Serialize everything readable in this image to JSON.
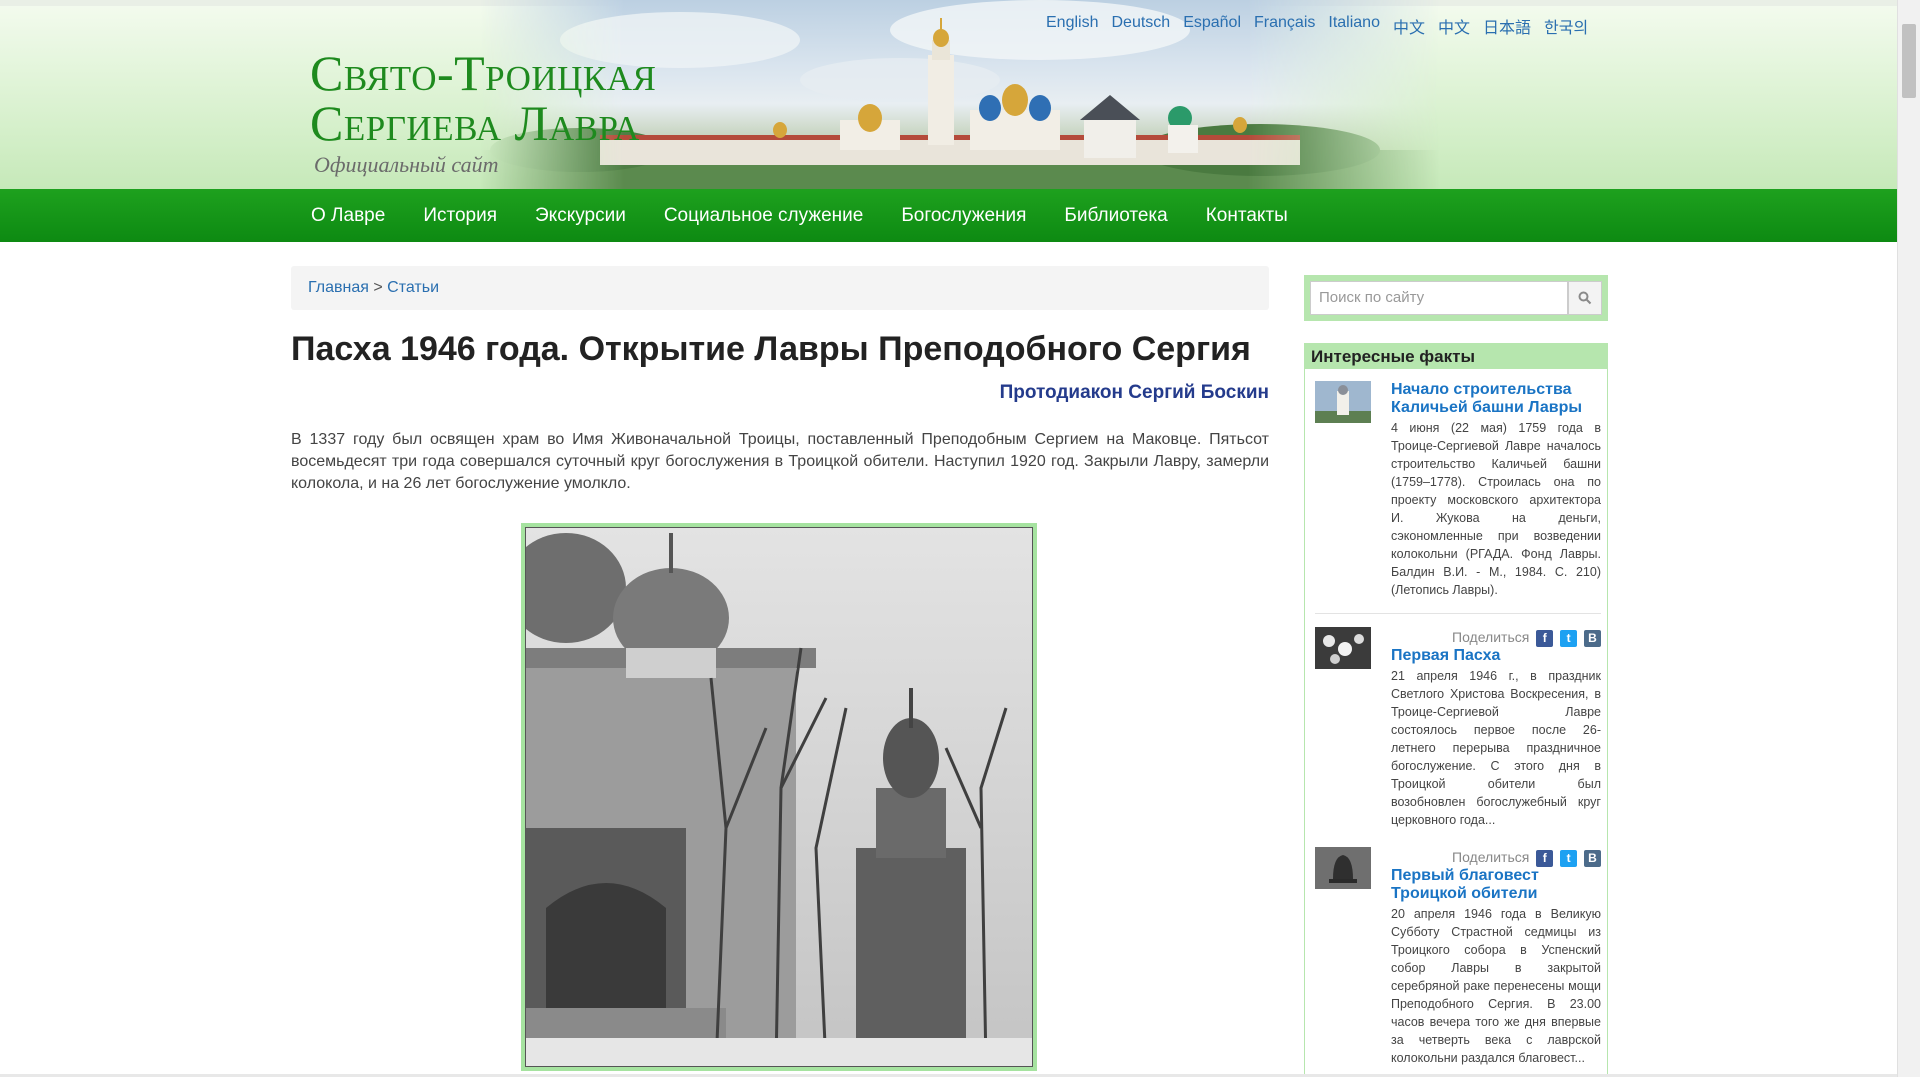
{
  "header": {
    "logo_line1": "Свято-Троицкая",
    "logo_line2": "Сергиева Лавра",
    "logo_subtitle": "Официальный сайт",
    "languages": [
      "English",
      "Deutsch",
      "Español",
      "Français",
      "Italiano",
      "中文",
      "中文",
      "日本語",
      "한국의"
    ]
  },
  "nav": {
    "items": [
      "О Лавре",
      "История",
      "Экскурсии",
      "Социальное служение",
      "Богослужения",
      "Библиотека",
      "Контакты"
    ]
  },
  "breadcrumb": {
    "home": "Главная",
    "separator": ">",
    "current": "Статьи"
  },
  "article": {
    "title": "Пасха 1946 года. Открытие Лавры Преподобного Сергия",
    "author": "Протодиакон Сергий Боскин",
    "lead": "В 1337 году был освящен храм во Имя Живоначальной Троицы, поставленный Преподобным Сергием на Маковце. Пятьсот восемьдесят три года совершался суточный круг богослужения в Троицкой обители. Наступил 1920 год. Закрыли Лавру, замерли колокола, и на 26 лет богослужение умолкло."
  },
  "search": {
    "placeholder": "Поиск по сайту",
    "icon": "search-icon"
  },
  "sidebar": {
    "heading": "Интересные факты",
    "share_label": "Поделиться",
    "items": [
      {
        "title": "Начало строительства Каличьей башни Лавры",
        "text": "4 июня (22 мая) 1759 года в Троице-Сергиевой Лавре началось строительство Каличьей башни (1759–1778). Строилась она по проекту московского архитектора И. Жукова на деньги, сэкономленные при возведении колокольни (РГАДА. Фонд Лавры. Балдин В.И. - М., 1984. С. 210) (Летопись Лавры)."
      },
      {
        "title": "Первая Пасха",
        "text": "21 апреля 1946 г., в праздник Светлого Христова Воскресения, в Троице-Сергиевой Лавре состоялось первое после 26-летнего перерыва праздничное богослужение. С этого дня в Троицкой обители был возобновлен богослужебный круг церковного года..."
      },
      {
        "title": "Первый благовест Троицкой обители",
        "text": "20 апреля 1946 года в Великую Субботу Страстной седмицы из Троицкого собора в Успенский собор Лавры в закрытой серебряной раке перенесены мощи Преподобного Сергия. В 23.00 часов вечера того же дня впервые за четверть века с лаврской колокольни раздался благовест..."
      }
    ],
    "share_icons": {
      "facebook": "f",
      "twitter": "t",
      "vk": "B"
    }
  },
  "colors": {
    "brand_green": "#1e8a1e",
    "nav_green": "#0d8a12",
    "link_blue": "#2a6fb0",
    "author_blue": "#243b8c",
    "panel_green": "#b6e6ae"
  }
}
